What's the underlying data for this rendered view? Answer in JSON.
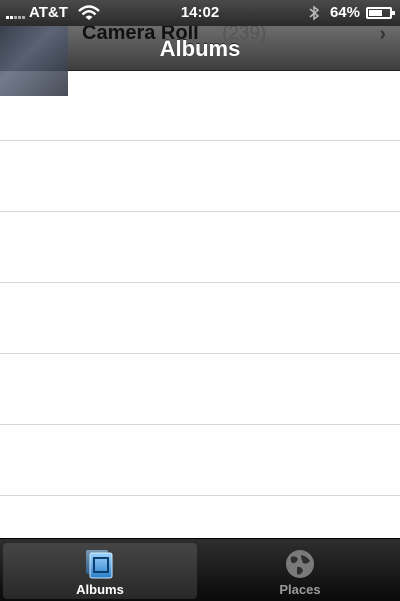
{
  "status_bar": {
    "carrier": "AT&T",
    "time": "14:02",
    "battery_percent": "64%",
    "battery_level": 0.64,
    "icons": [
      "signal-icon",
      "wifi-icon",
      "bluetooth-icon",
      "battery-icon"
    ]
  },
  "header": {
    "title": "Albums",
    "behind_row": {
      "title": "Camera Roll",
      "count": "(239)"
    }
  },
  "list": {
    "rows": 7
  },
  "tab_bar": {
    "tabs": [
      {
        "label": "Albums",
        "icon": "albums-icon",
        "active": true
      },
      {
        "label": "Places",
        "icon": "globe-icon",
        "active": false
      }
    ]
  },
  "colors": {
    "accent": "#4aa3e8",
    "tabbar": "#1a1a1a",
    "navbar": "#555555"
  }
}
